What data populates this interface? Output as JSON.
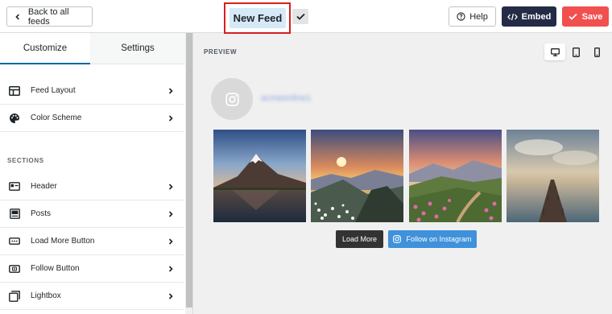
{
  "topbar": {
    "back_label": "Back to all feeds",
    "feed_title": "New Feed",
    "help_label": "Help",
    "embed_label": "Embed",
    "save_label": "Save"
  },
  "sidebar": {
    "tabs": [
      {
        "label": "Customize",
        "active": true
      },
      {
        "label": "Settings",
        "active": false
      }
    ],
    "top_items": [
      {
        "label": "Feed Layout",
        "icon": "feed-layout-icon"
      },
      {
        "label": "Color Scheme",
        "icon": "palette-icon"
      }
    ],
    "sections_label": "SECTIONS",
    "section_items": [
      {
        "label": "Header",
        "icon": "header-icon"
      },
      {
        "label": "Posts",
        "icon": "posts-icon"
      },
      {
        "label": "Load More Button",
        "icon": "load-more-icon"
      },
      {
        "label": "Follow Button",
        "icon": "follow-button-icon"
      },
      {
        "label": "Lightbox",
        "icon": "lightbox-icon"
      }
    ]
  },
  "preview": {
    "label": "PREVIEW",
    "devices": [
      "desktop",
      "tablet",
      "mobile"
    ],
    "active_device": "desktop",
    "username": "acmeonline1",
    "photos": [
      "snow-mountain-lake",
      "sunset-valley-flowers",
      "hills-pink-flowers",
      "ocean-pier"
    ],
    "load_more_label": "Load More",
    "follow_label": "Follow on Instagram"
  },
  "colors": {
    "accent_blue": "#0068a0",
    "embed_dark": "#242b46",
    "save_red": "#f24f4f",
    "follow_blue": "#3f91da",
    "highlight_red": "#d61f1f",
    "title_bg": "#d6e9f7"
  }
}
